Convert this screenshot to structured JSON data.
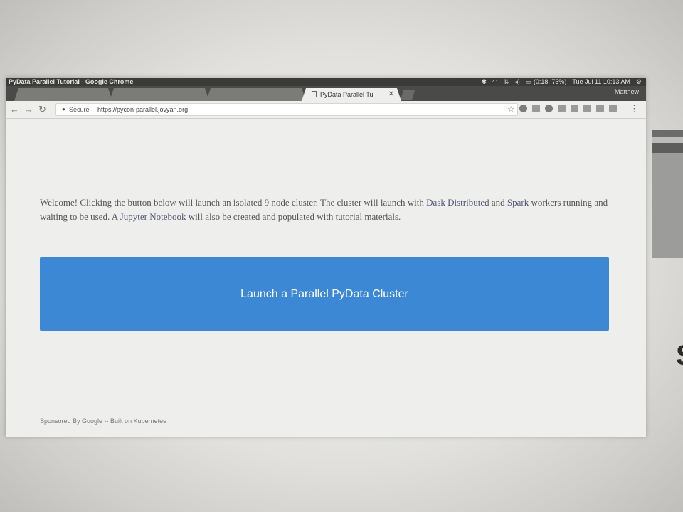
{
  "window": {
    "title": "PyData Parallel Tutorial - Google Chrome",
    "tray": {
      "battery": "(0:18, 75%)",
      "datetime": "Tue Jul 11 10:13 AM"
    },
    "user": "Matthew"
  },
  "tabs": [
    {
      "label": "",
      "active": false
    },
    {
      "label": "",
      "active": false
    },
    {
      "label": "",
      "active": false
    },
    {
      "label": "PyData Parallel Tu",
      "active": true
    }
  ],
  "toolbar": {
    "secure_label": "Secure",
    "url": "https://pycon-parallel.jovyan.org"
  },
  "page": {
    "intro_part1": "Welcome! Clicking the button below will launch an isolated 9 node cluster. The cluster will launch with ",
    "link_dask": "Dask Distributed",
    "intro_and": " and ",
    "link_spark": "Spark",
    "intro_part2": " workers running and waiting to be used. A ",
    "link_jupyter": "Jupyter Notebook",
    "intro_part3": " will also be created and populated with tutorial materials.",
    "launch_button": "Launch a Parallel PyData Cluster",
    "footer": "Sponsored By Google -- Built on Kubernetes"
  },
  "colors": {
    "button": "#3c88d4",
    "titlebar": "#3b3b39",
    "page_bg": "#eeeeec"
  }
}
